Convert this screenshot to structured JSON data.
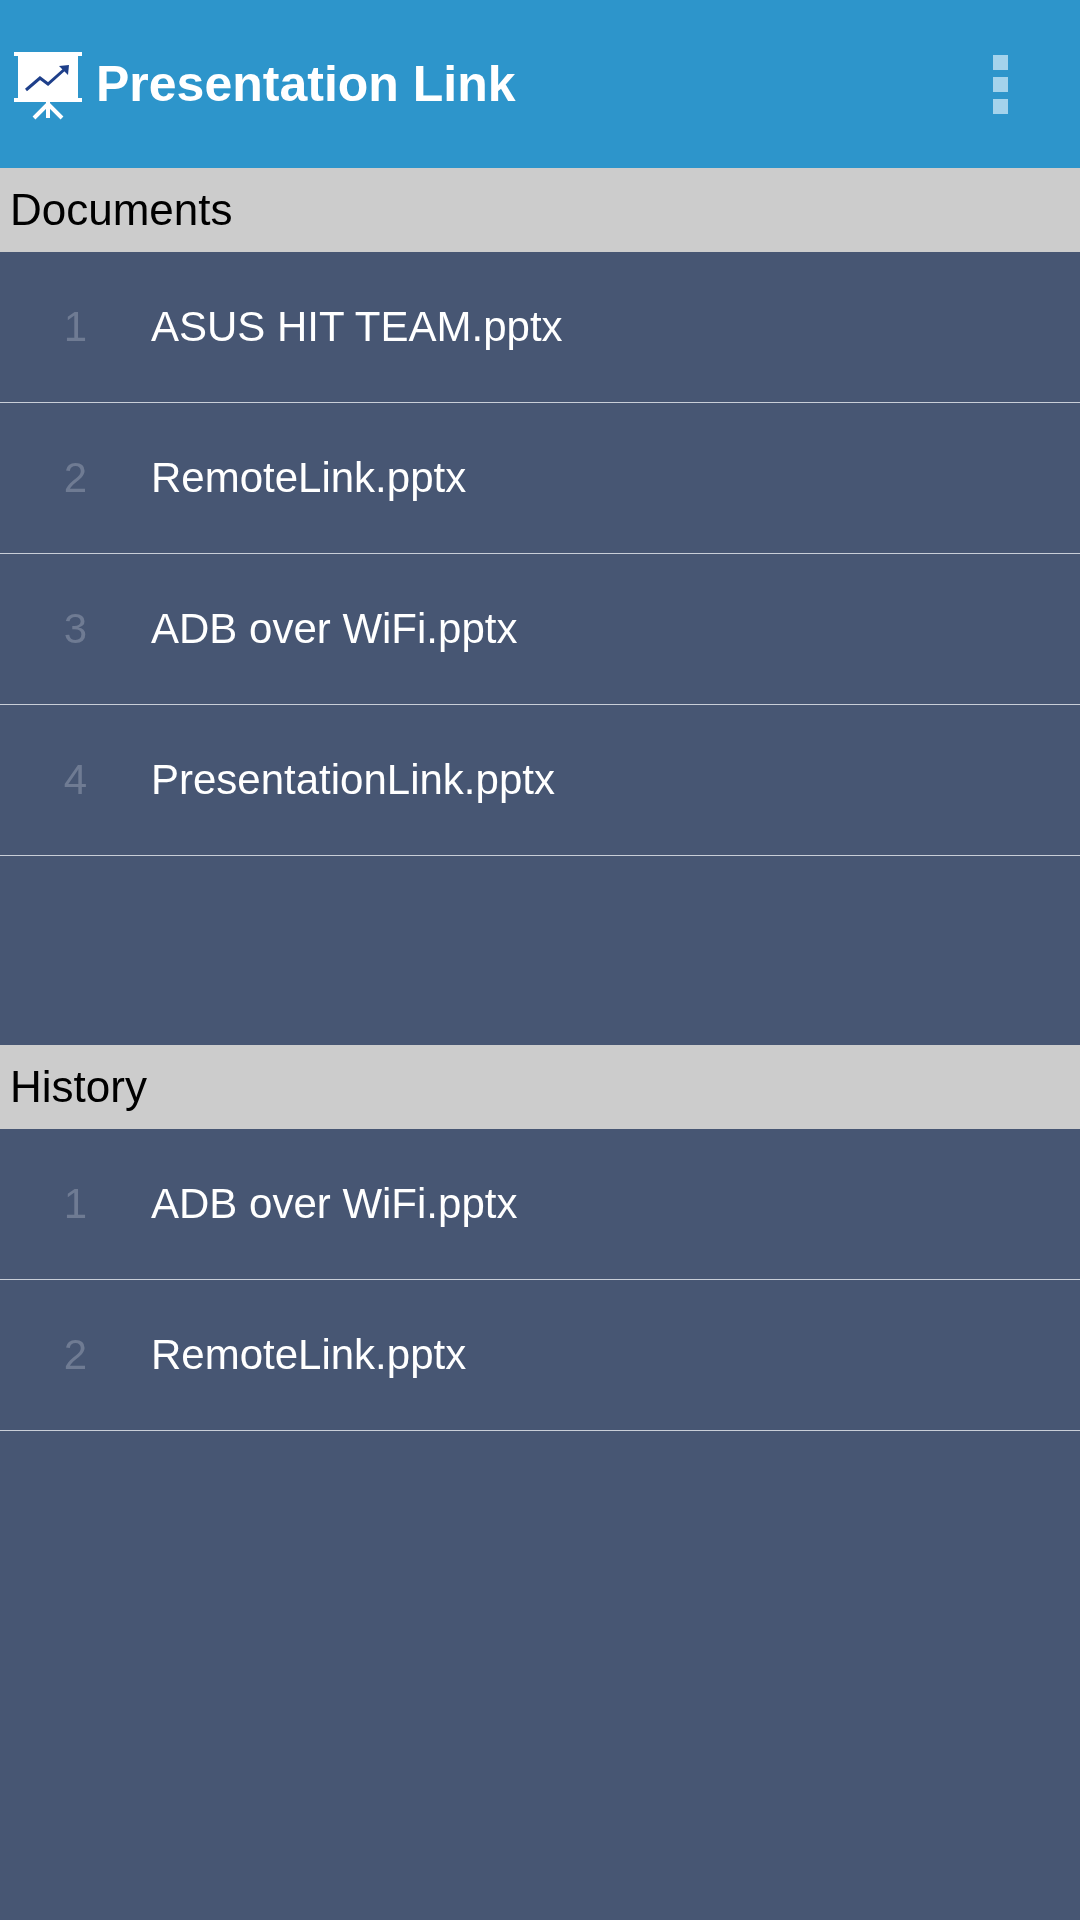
{
  "app_bar": {
    "title": "Presentation Link"
  },
  "sections": [
    {
      "title": "Documents",
      "items": [
        {
          "number": "1",
          "name": "ASUS HIT TEAM.pptx"
        },
        {
          "number": "2",
          "name": "RemoteLink.pptx"
        },
        {
          "number": "3",
          "name": "ADB over WiFi.pptx"
        },
        {
          "number": "4",
          "name": "PresentationLink.pptx"
        }
      ]
    },
    {
      "title": "History",
      "items": [
        {
          "number": "1",
          "name": "ADB over WiFi.pptx"
        },
        {
          "number": "2",
          "name": "RemoteLink.pptx"
        }
      ]
    }
  ]
}
